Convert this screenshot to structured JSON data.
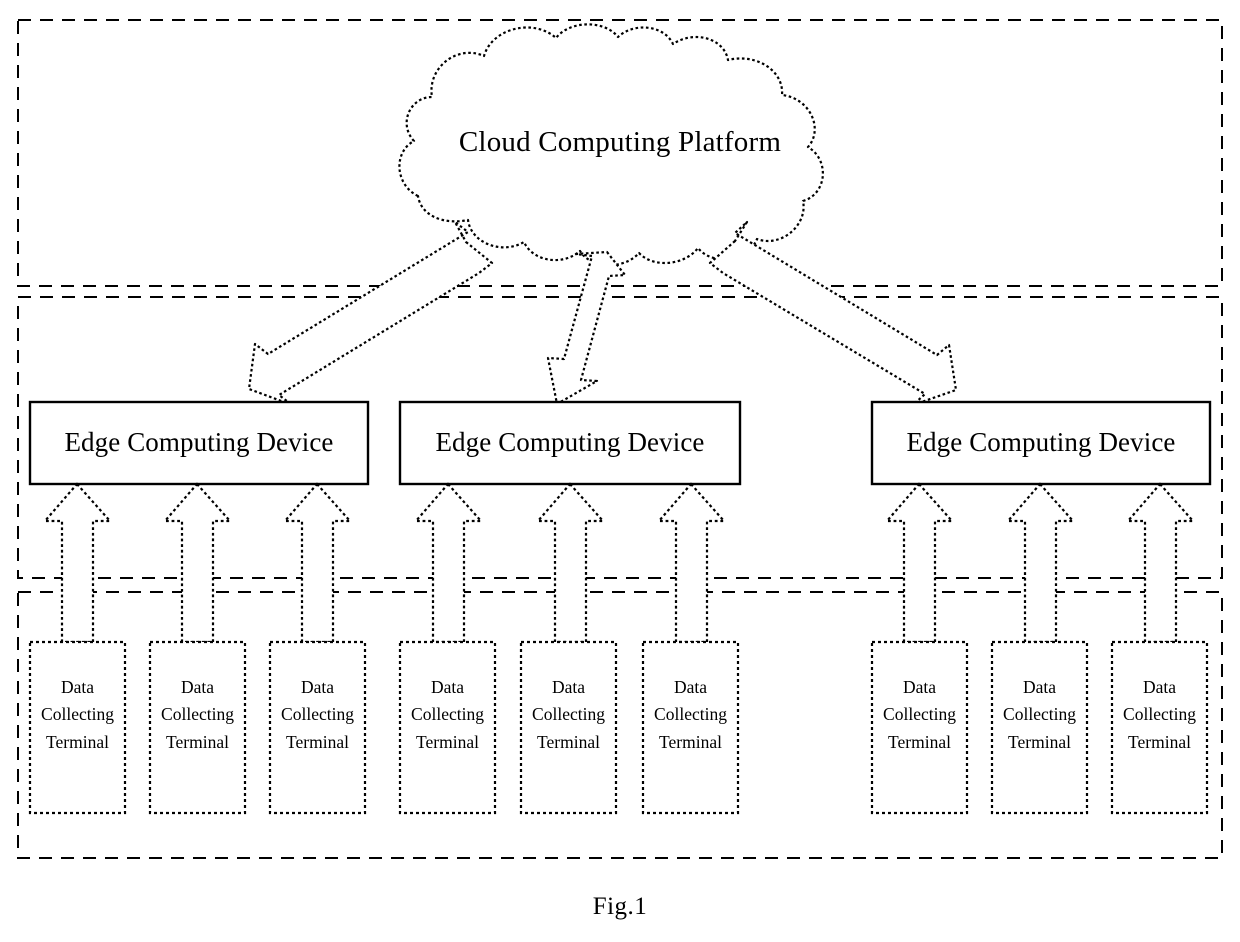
{
  "figure": {
    "caption": "Fig.1",
    "background": "#ffffff",
    "stroke": "#000000"
  },
  "cloud": {
    "label": "Cloud Computing Platform",
    "shape": "cloud",
    "border_style": "dotted"
  },
  "layers": [
    {
      "name": "cloud-layer",
      "border_style": "dashed"
    },
    {
      "name": "edge-layer",
      "border_style": "dashed"
    },
    {
      "name": "terminal-layer",
      "border_style": "dashed"
    }
  ],
  "edge_devices": [
    {
      "label": "Edge Computing Device"
    },
    {
      "label": "Edge Computing Device"
    },
    {
      "label": "Edge Computing Device"
    }
  ],
  "terminals": [
    {
      "line1": "Data",
      "line2": "Collecting",
      "line3": "Terminal"
    },
    {
      "line1": "Data",
      "line2": "Collecting",
      "line3": "Terminal"
    },
    {
      "line1": "Data",
      "line2": "Collecting",
      "line3": "Terminal"
    },
    {
      "line1": "Data",
      "line2": "Collecting",
      "line3": "Terminal"
    },
    {
      "line1": "Data",
      "line2": "Collecting",
      "line3": "Terminal"
    },
    {
      "line1": "Data",
      "line2": "Collecting",
      "line3": "Terminal"
    },
    {
      "line1": "Data",
      "line2": "Collecting",
      "line3": "Terminal"
    },
    {
      "line1": "Data",
      "line2": "Collecting",
      "line3": "Terminal"
    },
    {
      "line1": "Data",
      "line2": "Collecting",
      "line3": "Terminal"
    }
  ],
  "connectors": {
    "cloud_to_edge": {
      "style": "double-headed-block-arrow",
      "count": 3
    },
    "terminal_to_edge": {
      "style": "up-block-arrow",
      "count": 9
    }
  }
}
